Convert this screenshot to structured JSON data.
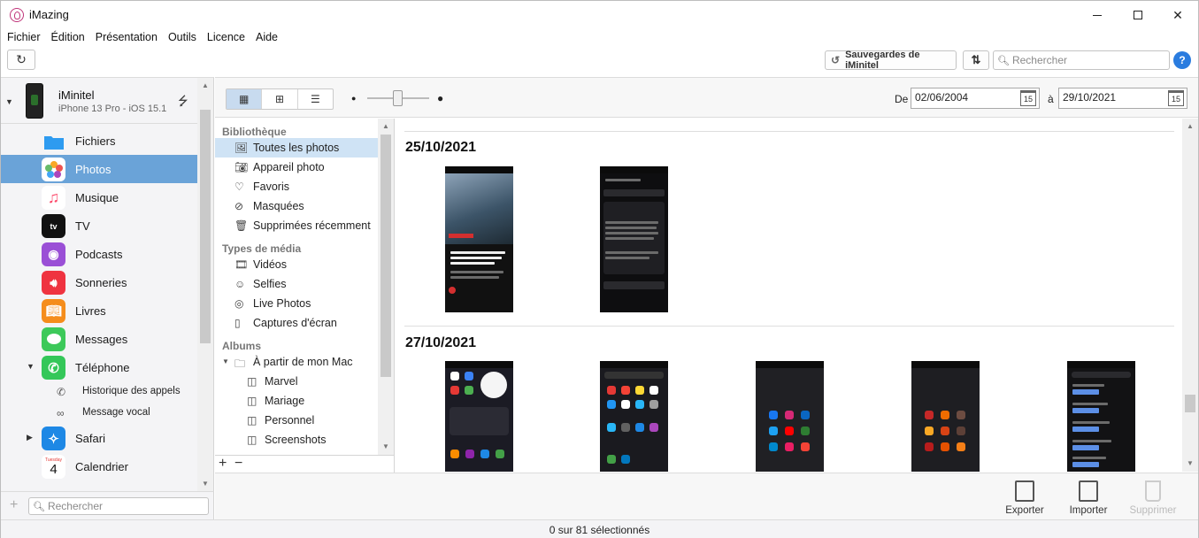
{
  "window": {
    "title": "iMazing"
  },
  "menu": [
    "Fichier",
    "Édition",
    "Présentation",
    "Outils",
    "Licence",
    "Aide"
  ],
  "toolbar": {
    "backup_label": "Sauvegardes de iMinitel",
    "search_placeholder": "Rechercher",
    "help": "?"
  },
  "device": {
    "name": "iMinitel",
    "model": "iPhone 13 Pro - iOS 15.1"
  },
  "sidebar": {
    "items": [
      {
        "label": "Fichiers",
        "color": "#2e9bf0"
      },
      {
        "label": "Photos",
        "color": "#ffffff",
        "active": true
      },
      {
        "label": "Musique",
        "color": "#fc4a6b"
      },
      {
        "label": "TV",
        "color": "#111111"
      },
      {
        "label": "Podcasts",
        "color": "#9a4fd6"
      },
      {
        "label": "Sonneries",
        "color": "#ef3340"
      },
      {
        "label": "Livres",
        "color": "#f58d1c"
      },
      {
        "label": "Messages",
        "color": "#3dc95a"
      },
      {
        "label": "Téléphone",
        "color": "#34c759"
      },
      {
        "label": "Safari",
        "color": "#1e88e5"
      },
      {
        "label": "Calendrier",
        "color": "#ffffff"
      }
    ],
    "sub_items": [
      "Historique des appels",
      "Message vocal"
    ],
    "calendar_day": "Tuesday",
    "calendar_num": "4",
    "tv_glyph": "tv",
    "search_placeholder": "Rechercher"
  },
  "library": {
    "section_library": "Bibliothèque",
    "library_items": [
      "Toutes les photos",
      "Appareil photo",
      "Favoris",
      "Masquées",
      "Supprimées récemment"
    ],
    "section_media": "Types de média",
    "media_items": [
      "Vidéos",
      "Selfies",
      "Live Photos",
      "Captures d'écran"
    ],
    "section_albums": "Albums",
    "album_group": "À partir de mon Mac",
    "albums": [
      "Marvel",
      "Mariage",
      "Personnel",
      "Screenshots"
    ]
  },
  "filter": {
    "from_label": "De",
    "from_date": "02/06/2004",
    "to_label": "à",
    "to_date": "29/10/2021",
    "cal_day": "15"
  },
  "groups": [
    {
      "date": "25/10/2021"
    },
    {
      "date": "27/10/2021"
    }
  ],
  "actions": {
    "export": "Exporter",
    "import": "Importer",
    "delete": "Supprimer"
  },
  "status": {
    "selection": "0 sur 81 sélectionnés"
  }
}
